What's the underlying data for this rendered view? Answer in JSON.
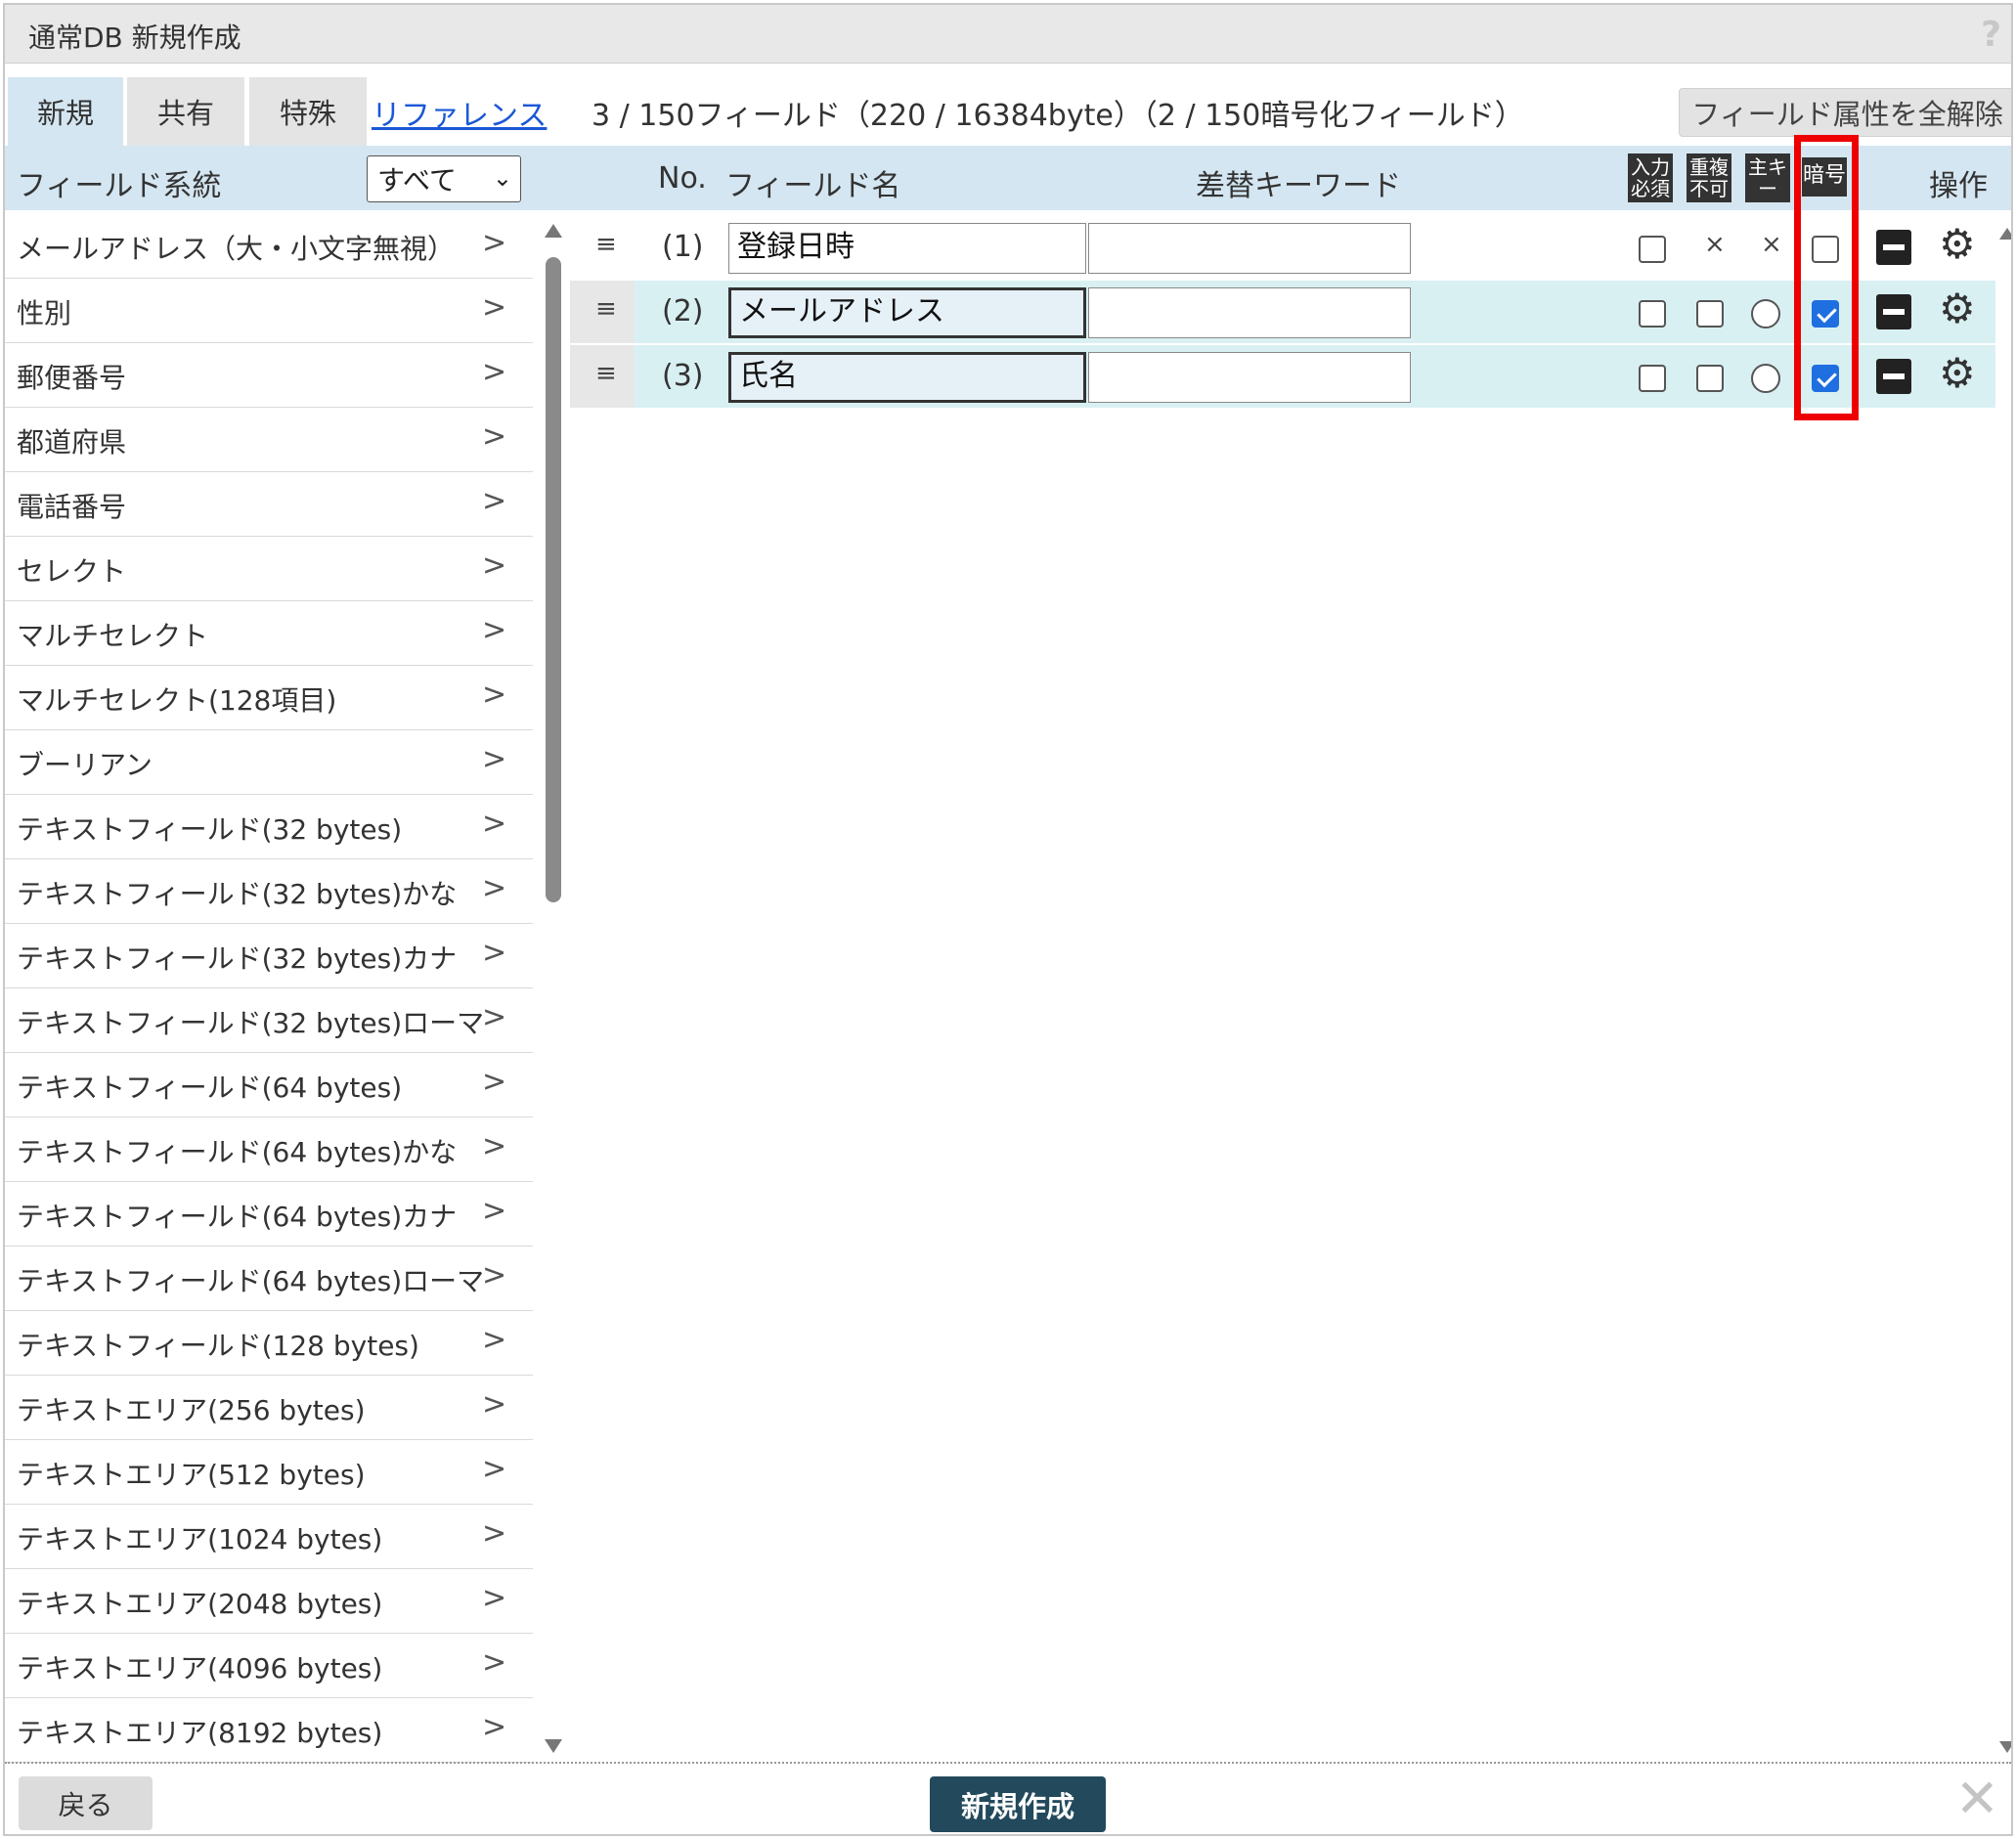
{
  "dialog": {
    "title": "通常DB 新規作成",
    "help_icon": "?",
    "close_icon": "✕"
  },
  "tabs": [
    {
      "label": "新規",
      "active": true
    },
    {
      "label": "共有",
      "active": false
    },
    {
      "label": "特殊",
      "active": false
    }
  ],
  "reference_link": "リファレンス",
  "field_count_text": "3 / 150フィールド（220 / 16384byte）（2 / 150暗号化フィールド）",
  "clear_attributes_button": "フィールド属性を全解除",
  "left_panel": {
    "header": "フィールド系統",
    "filter_select": "すべて",
    "arrow": ">",
    "items": [
      "メールアドレス（大・小文字無視）",
      "性別",
      "郵便番号",
      "都道府県",
      "電話番号",
      "セレクト",
      "マルチセレクト",
      "マルチセレクト(128項目)",
      "ブーリアン",
      "テキストフィールド(32 bytes)",
      "テキストフィールド(32 bytes)かな",
      "テキストフィールド(32 bytes)カナ",
      "テキストフィールド(32 bytes)ローマ",
      "テキストフィールド(64 bytes)",
      "テキストフィールド(64 bytes)かな",
      "テキストフィールド(64 bytes)カナ",
      "テキストフィールド(64 bytes)ローマ",
      "テキストフィールド(128 bytes)",
      "テキストエリア(256 bytes)",
      "テキストエリア(512 bytes)",
      "テキストエリア(1024 bytes)",
      "テキストエリア(2048 bytes)",
      "テキストエリア(4096 bytes)",
      "テキストエリア(8192 bytes)"
    ]
  },
  "columns": {
    "no": "No.",
    "field_name": "フィールド名",
    "keyword": "差替キーワード",
    "required": "入力必須",
    "unique": "重複不可",
    "primary_key": "主キー",
    "encrypt": "暗号",
    "operations": "操作"
  },
  "fields": [
    {
      "no": "(1)",
      "name": "登録日時",
      "keyword": "",
      "locked": false,
      "highlight": false,
      "required": false,
      "unique": "×",
      "primary_key": "×",
      "encrypt": false
    },
    {
      "no": "(2)",
      "name": "メールアドレス",
      "keyword": "",
      "locked": true,
      "highlight": true,
      "required": false,
      "unique": "checkbox",
      "primary_key": "radio",
      "encrypt": true
    },
    {
      "no": "(3)",
      "name": "氏名",
      "keyword": "",
      "locked": true,
      "highlight": true,
      "required": false,
      "unique": "checkbox",
      "primary_key": "radio",
      "encrypt": true
    }
  ],
  "drag_handle": "≡",
  "gear_glyph": "⚙",
  "footer": {
    "back_button": "戻る",
    "create_button": "新規作成"
  },
  "colors": {
    "header_band": "#d4e6f1",
    "row_highlight": "#d9f0f2",
    "create_button": "#234a5c",
    "checkbox_checked": "#1f6fe0",
    "annotation_red": "#ee0000",
    "link": "#1a57d6"
  }
}
